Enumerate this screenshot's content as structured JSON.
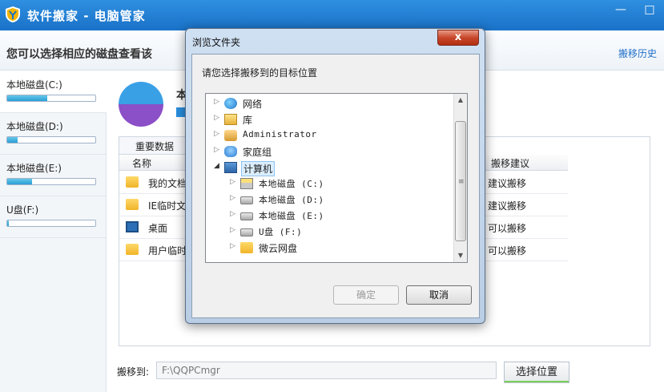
{
  "window": {
    "title": "软件搬家 - 电脑管家",
    "minimize_glyph": "—",
    "maximize_glyph": "□"
  },
  "header": {
    "instruction": "您可以选择相应的磁盘查看该",
    "history_link": "搬移历史"
  },
  "sidebar": {
    "items": [
      {
        "label": "本地磁盘(C:)",
        "usage": 0.45,
        "selected": true
      },
      {
        "label": "本地磁盘(D:)",
        "usage": 0.12,
        "selected": false
      },
      {
        "label": "本地磁盘(E:)",
        "usage": 0.28,
        "selected": false
      },
      {
        "label": "U盘(F:)",
        "usage": 0.02,
        "selected": false
      }
    ]
  },
  "main": {
    "disk_title_partial": "本",
    "tab_label": "重要数据",
    "columns": {
      "name": "名称",
      "suggestion": "搬移建议"
    },
    "rows": [
      {
        "icon": "folder-icon",
        "name": "我的文档",
        "suggestion": "建议搬移"
      },
      {
        "icon": "folder-icon",
        "name": "IE临时文",
        "suggestion": "建议搬移"
      },
      {
        "icon": "monitor-icon",
        "name": "桌面",
        "suggestion": "可以搬移"
      },
      {
        "icon": "folder-icon",
        "name": "用户临时",
        "suggestion": "可以搬移"
      }
    ],
    "move_to_label": "搬移到:",
    "move_to_value": "F:\\QQPCmgr",
    "choose_button": "选择位置"
  },
  "dialog": {
    "title": "浏览文件夹",
    "close_glyph": "x",
    "prompt": "请您选择搬移到的目标位置",
    "tree": [
      {
        "label": "网络",
        "icon": "network-icon",
        "level": 0,
        "expanded": false,
        "mono": false,
        "selected": false
      },
      {
        "label": "库",
        "icon": "library-icon",
        "level": 0,
        "expanded": false,
        "mono": false,
        "selected": false
      },
      {
        "label": "Administrator",
        "icon": "user-folder-icon",
        "level": 0,
        "expanded": false,
        "mono": true,
        "selected": false
      },
      {
        "label": "家庭组",
        "icon": "homegroup-icon",
        "level": 0,
        "expanded": false,
        "mono": false,
        "selected": false
      },
      {
        "label": "计算机",
        "icon": "computer-icon",
        "level": 0,
        "expanded": true,
        "mono": false,
        "selected": true
      },
      {
        "label": "本地磁盘 (C:)",
        "icon": "system-drive-icon",
        "level": 1,
        "expanded": false,
        "mono": true,
        "selected": false
      },
      {
        "label": "本地磁盘 (D:)",
        "icon": "drive-icon",
        "level": 1,
        "expanded": false,
        "mono": true,
        "selected": false
      },
      {
        "label": "本地磁盘 (E:)",
        "icon": "drive-icon",
        "level": 1,
        "expanded": false,
        "mono": true,
        "selected": false
      },
      {
        "label": "U盘 (F:)",
        "icon": "usb-drive-icon",
        "level": 1,
        "expanded": false,
        "mono": true,
        "selected": false
      },
      {
        "label": "微云网盘",
        "icon": "folder-icon",
        "level": 1,
        "expanded": false,
        "mono": false,
        "selected": false
      }
    ],
    "ok_button": "确定",
    "ok_enabled": false,
    "cancel_button": "取消"
  },
  "colors": {
    "titlebar": "#1a72c8",
    "disk_bar": "#2a9ed6",
    "pie_used": "#8b4fc7",
    "pie_free": "#3aa0e6",
    "accent_green": "#7ccf5a"
  }
}
